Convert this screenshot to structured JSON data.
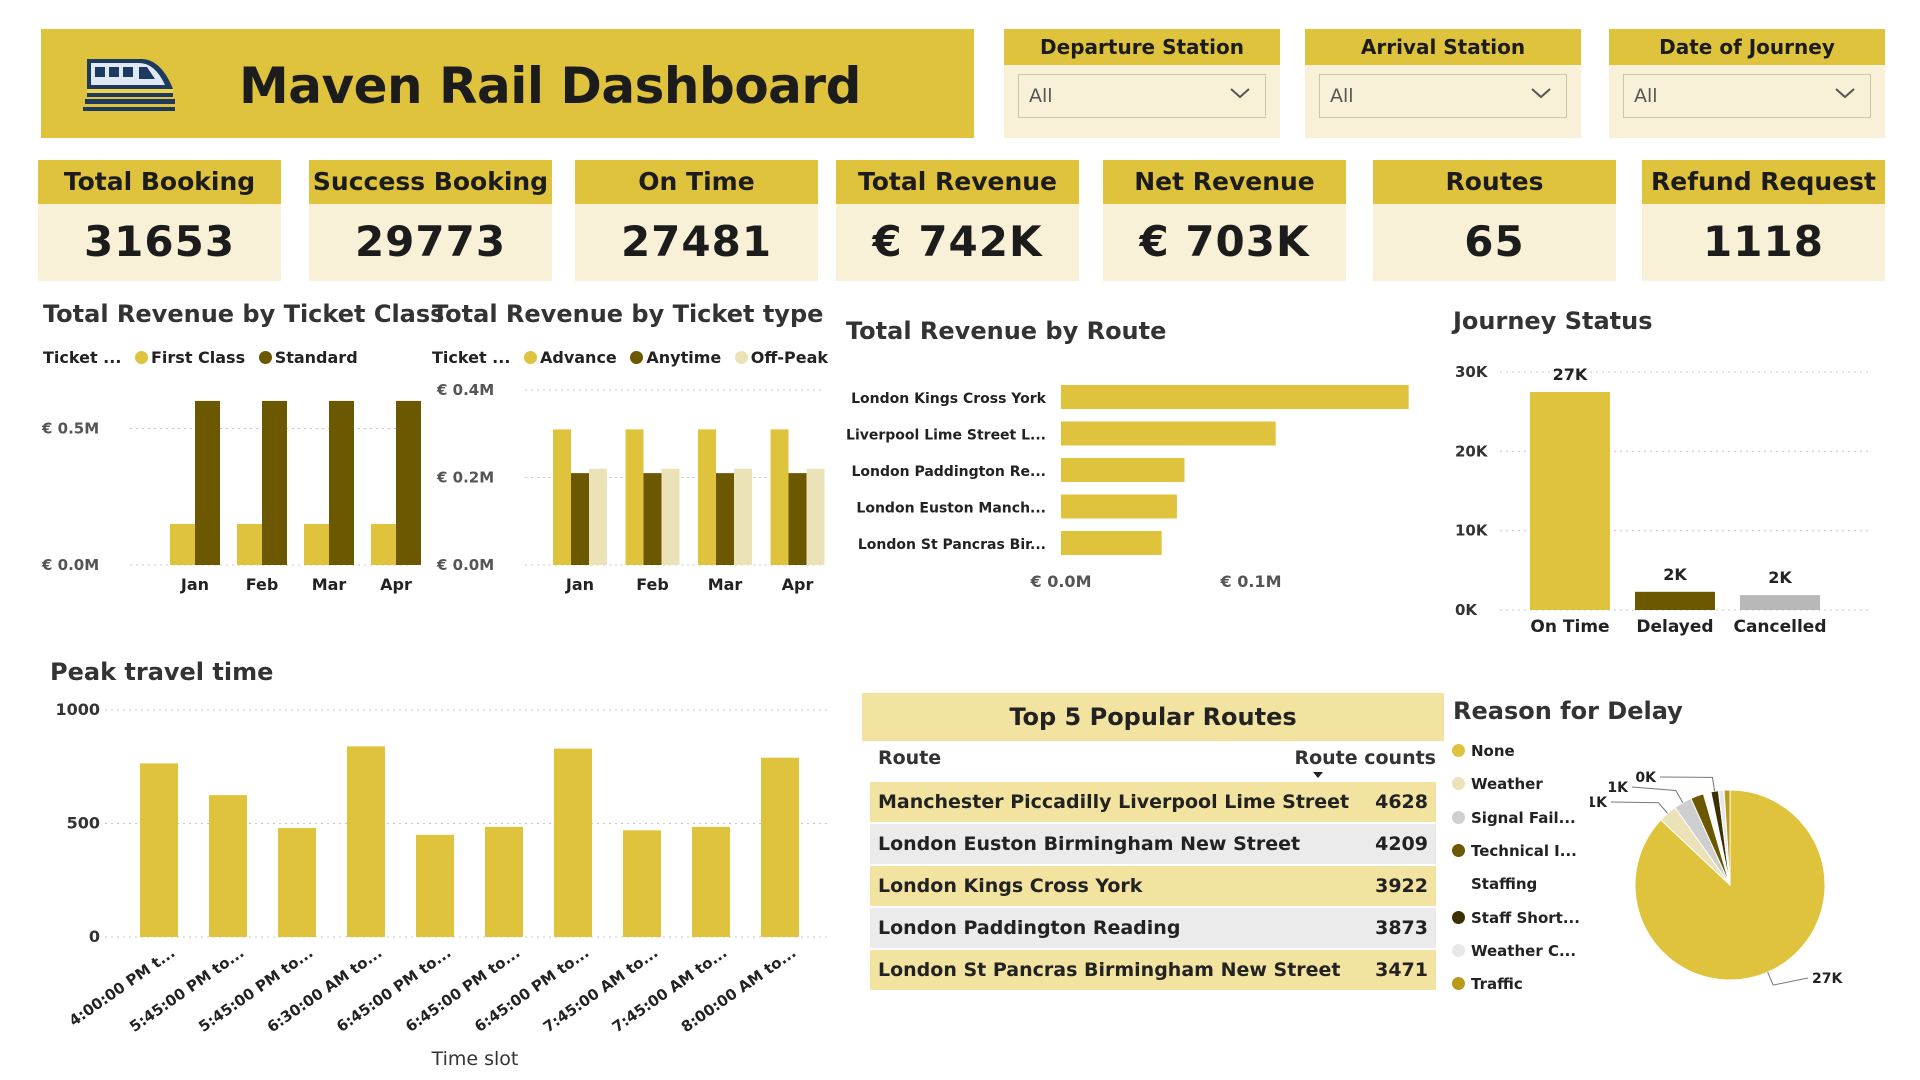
{
  "header": {
    "title": "Maven Rail Dashboard",
    "icon": "train-icon"
  },
  "slicers": [
    {
      "label": "Departure Station",
      "value": "All"
    },
    {
      "label": "Arrival Station",
      "value": "All"
    },
    {
      "label": "Date of Journey",
      "value": "All"
    }
  ],
  "kpis": [
    {
      "label": "Total Booking",
      "value": "31653"
    },
    {
      "label": "Success Booking",
      "value": "29773"
    },
    {
      "label": "On Time",
      "value": "27481"
    },
    {
      "label": "Total Revenue",
      "value": "€ 742K"
    },
    {
      "label": "Net Revenue",
      "value": "€ 703K"
    },
    {
      "label": "Routes",
      "value": "65"
    },
    {
      "label": "Refund Request",
      "value": "1118"
    }
  ],
  "colors": {
    "gold": "#e0c33d",
    "dark_olive": "#6b5800",
    "pale": "#ece2b7",
    "cream": "#f8f1d8",
    "grey": "#b8b8b8"
  },
  "chart_data": [
    {
      "type": "bar",
      "title": "Total Revenue by Ticket Class",
      "legend_title": "Ticket ...",
      "categories": [
        "Jan",
        "Feb",
        "Mar",
        "Apr"
      ],
      "series": [
        {
          "name": "First Class",
          "values": [
            0.15,
            0.15,
            0.15,
            0.15
          ],
          "color": "#e0c33d"
        },
        {
          "name": "Standard",
          "values": [
            0.6,
            0.6,
            0.6,
            0.6
          ],
          "color": "#6b5800"
        }
      ],
      "y_ticks": [
        "€ 0.0M",
        "€ 0.5M"
      ],
      "ylim": [
        0,
        0.64
      ]
    },
    {
      "type": "bar",
      "title": "Total Revenue by Ticket type",
      "legend_title": "Ticket ...",
      "categories": [
        "Jan",
        "Feb",
        "Mar",
        "Apr"
      ],
      "series": [
        {
          "name": "Advance",
          "values": [
            0.31,
            0.31,
            0.31,
            0.31
          ],
          "color": "#e0c33d"
        },
        {
          "name": "Anytime",
          "values": [
            0.21,
            0.21,
            0.21,
            0.21
          ],
          "color": "#6b5800"
        },
        {
          "name": "Off-Peak",
          "values": [
            0.22,
            0.22,
            0.22,
            0.22
          ],
          "color": "#ece2b7"
        }
      ],
      "y_ticks": [
        "€ 0.0M",
        "€ 0.2M",
        "€ 0.4M"
      ],
      "ylim": [
        0,
        0.4
      ]
    },
    {
      "type": "bar",
      "orientation": "horizontal",
      "title": "Total Revenue by Route",
      "categories": [
        "London Kings Cross York",
        "Liverpool Lime Street L...",
        "London Paddington Re...",
        "London Euston Manch...",
        "London St Pancras Bir..."
      ],
      "values": [
        0.183,
        0.113,
        0.065,
        0.061,
        0.053
      ],
      "x_ticks": [
        "€ 0.0M",
        "€ 0.1M",
        "€ 0."
      ],
      "xlim": [
        0,
        0.2
      ]
    },
    {
      "type": "bar",
      "title": "Journey Status",
      "categories": [
        "On Time",
        "Delayed",
        "Cancelled"
      ],
      "values": [
        27481,
        2292,
        1880
      ],
      "data_labels": [
        "27K",
        "2K",
        "2K"
      ],
      "colors": [
        "#e0c33d",
        "#6b5800",
        "#b8b8b8"
      ],
      "y_ticks": [
        "0K",
        "10K",
        "20K",
        "30K"
      ],
      "ylim": [
        0,
        30000
      ]
    },
    {
      "type": "bar",
      "title": "Peak travel time",
      "xlabel": "Time slot",
      "categories": [
        "4:00:00 PM t...",
        "5:45:00 PM to...",
        "5:45:00 PM to...",
        "6:30:00 AM to...",
        "6:45:00 PM to...",
        "6:45:00 PM to...",
        "6:45:00 PM to...",
        "7:45:00 AM to...",
        "7:45:00 AM to...",
        "8:00:00 AM to..."
      ],
      "values": [
        765,
        625,
        480,
        840,
        450,
        485,
        830,
        470,
        485,
        790
      ],
      "y_ticks": [
        "0",
        "500",
        "1000"
      ],
      "ylim": [
        0,
        1000
      ]
    },
    {
      "type": "pie",
      "title": "Reason for Delay",
      "categories": [
        "None",
        "Weather",
        "Signal Fail...",
        "Technical I...",
        "Staffing",
        "Staff Short...",
        "Weather C...",
        "Traffic"
      ],
      "values": [
        27481,
        995,
        970,
        707,
        410,
        399,
        302,
        314
      ],
      "colors": [
        "#e0c33d",
        "#ece2b7",
        "#cfcfcf",
        "#6b5800",
        "#ffffff",
        "#3a3000",
        "#e8e8e8",
        "#b89a1a"
      ],
      "data_labels": [
        "27K",
        "1K",
        "1K",
        "0K"
      ]
    }
  ],
  "table": {
    "title": "Top 5 Popular Routes",
    "col_route": "Route",
    "col_count": "Route counts",
    "rows": [
      {
        "route": "Manchester Piccadilly Liverpool Lime Street",
        "count": "4628"
      },
      {
        "route": "London Euston Birmingham New Street",
        "count": "4209"
      },
      {
        "route": "London Kings Cross York",
        "count": "3922"
      },
      {
        "route": "London Paddington Reading",
        "count": "3873"
      },
      {
        "route": "London St Pancras Birmingham New Street",
        "count": "3471"
      }
    ]
  }
}
